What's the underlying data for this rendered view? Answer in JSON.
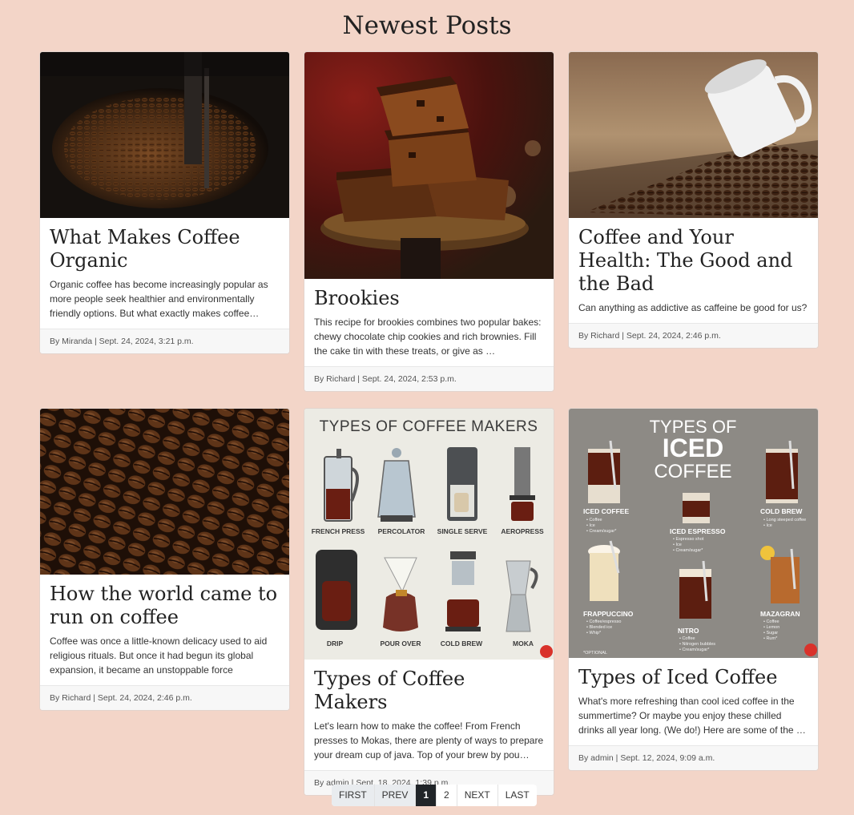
{
  "page": {
    "title": "Newest Posts"
  },
  "posts": [
    {
      "title": "What Makes Coffee Organic",
      "excerpt": "Organic coffee has become increasingly popular as more people seek healthier and environmentally friendly options. But what exactly makes coffee orga…",
      "meta": "By Miranda | Sept. 24, 2024, 3:21 p.m."
    },
    {
      "title": "Brookies",
      "excerpt": "This recipe for brookies combines two popular bakes: chewy chocolate chip cookies and rich brownies. Fill the cake tin with these treats, or give as …",
      "meta": "By Richard | Sept. 24, 2024, 2:53 p.m."
    },
    {
      "title": "Coffee and Your Health: The Good and the Bad",
      "excerpt": "Can anything as addictive as caffeine be good for us?",
      "meta": "By Richard | Sept. 24, 2024, 2:46 p.m."
    },
    {
      "title": "How the world came to run on coffee",
      "excerpt": "Coffee was once a little-known delicacy used to aid religious rituals. But once it had begun its global expansion, it became an unstoppable force",
      "meta": "By Richard | Sept. 24, 2024, 2:46 p.m."
    },
    {
      "title": "Types of Coffee Makers",
      "excerpt": "Let's learn how to make the coffee! From French presses to Mokas, there are plenty of ways to prepare your dream cup of java. Top of your brew by pou…",
      "meta": "By admin | Sept. 18, 2024, 1:39 p.m."
    },
    {
      "title": "Types of Iced Coffee",
      "excerpt": "What's more refreshing than cool iced coffee in the summertime? Or maybe you enjoy these chilled drinks all year long. (We do!) Here are some of the …",
      "meta": "By admin | Sept. 12, 2024, 9:09 a.m."
    }
  ],
  "infographic_makers": {
    "heading": "TYPES OF COFFEE MAKERS",
    "labels": [
      "FRENCH PRESS",
      "PERCOLATOR",
      "SINGLE SERVE",
      "AEROPRESS",
      "DRIP",
      "POUR OVER",
      "COLD BREW",
      "MOKA"
    ]
  },
  "infographic_iced": {
    "heading1": "TYPES OF",
    "heading2": "ICED",
    "heading3": "COFFEE",
    "labels": [
      "ICED COFFEE",
      "COLD BREW",
      "ICED ESPRESSO",
      "FRAPPUCCINO",
      "NITRO",
      "MAZAGRAN"
    ],
    "iced_coffee_items": [
      "• Coffee",
      "• Ice",
      "• Cream/sugar*"
    ],
    "cold_brew_items": [
      "• Long steeped coffee",
      "• Ice"
    ],
    "iced_espresso_items": [
      "• Espresso shot",
      "• Ice",
      "• Cream/sugar*"
    ],
    "frappuccino_items": [
      "• Coffee/espresso",
      "• Blended ice",
      "• Whip*"
    ],
    "nitro_items": [
      "• Coffee",
      "• Nitrogen bubbles",
      "• Cream/sugar*"
    ],
    "mazagran_items": [
      "• Coffee",
      "• Lemon",
      "• Sugar",
      "• Rum*"
    ],
    "footnote": "*OPTIONAL"
  },
  "pagination": {
    "first": "FIRST",
    "prev": "PREV",
    "current": "1",
    "page2": "2",
    "next": "NEXT",
    "last": "LAST"
  }
}
